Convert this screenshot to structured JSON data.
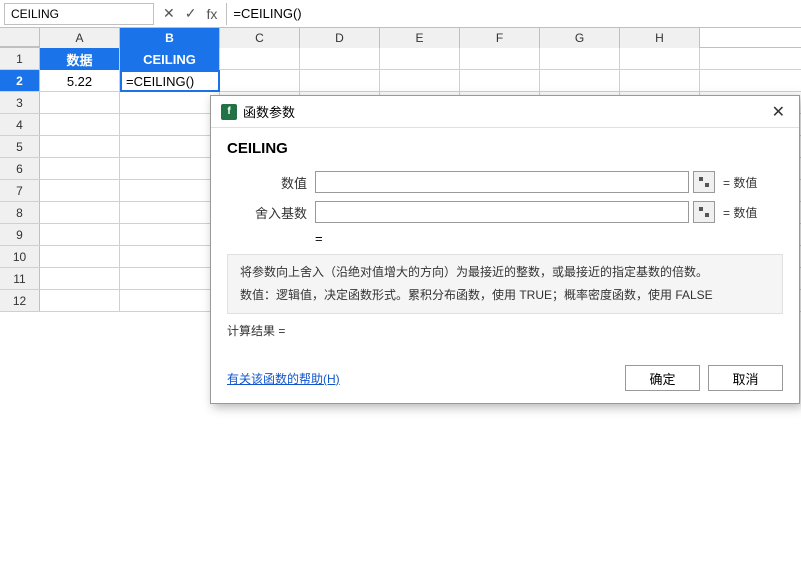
{
  "formulaBar": {
    "nameBox": "CEILING",
    "cancelIcon": "✕",
    "confirmIcon": "✓",
    "fxLabel": "fx",
    "formula": "=CEILING()"
  },
  "columns": [
    {
      "id": "A",
      "label": "A",
      "active": false
    },
    {
      "id": "B",
      "label": "B",
      "active": true
    },
    {
      "id": "C",
      "label": "C",
      "active": false
    },
    {
      "id": "D",
      "label": "D",
      "active": false
    },
    {
      "id": "E",
      "label": "E",
      "active": false
    },
    {
      "id": "F",
      "label": "F",
      "active": false
    },
    {
      "id": "G",
      "label": "G",
      "active": false
    },
    {
      "id": "H",
      "label": "H",
      "active": false
    }
  ],
  "rows": [
    {
      "num": "1",
      "active": false,
      "cells": [
        {
          "col": "A",
          "value": "数据",
          "type": "header"
        },
        {
          "col": "B",
          "value": "CEILING",
          "type": "header"
        },
        {
          "col": "C",
          "value": "",
          "type": "normal"
        },
        {
          "col": "D",
          "value": "",
          "type": "normal"
        },
        {
          "col": "E",
          "value": "",
          "type": "normal"
        },
        {
          "col": "F",
          "value": "",
          "type": "normal"
        },
        {
          "col": "G",
          "value": "",
          "type": "normal"
        }
      ]
    },
    {
      "num": "2",
      "active": true,
      "cells": [
        {
          "col": "A",
          "value": "5.22",
          "type": "value"
        },
        {
          "col": "B",
          "value": "=CEILING()",
          "type": "formula"
        },
        {
          "col": "C",
          "value": "",
          "type": "normal"
        },
        {
          "col": "D",
          "value": "",
          "type": "normal"
        },
        {
          "col": "E",
          "value": "",
          "type": "normal"
        },
        {
          "col": "F",
          "value": "",
          "type": "normal"
        },
        {
          "col": "G",
          "value": "",
          "type": "normal"
        }
      ]
    },
    {
      "num": "3",
      "active": false
    },
    {
      "num": "4",
      "active": false
    },
    {
      "num": "5",
      "active": false
    },
    {
      "num": "6",
      "active": false
    },
    {
      "num": "7",
      "active": false
    },
    {
      "num": "8",
      "active": false
    },
    {
      "num": "9",
      "active": false
    },
    {
      "num": "10",
      "active": false
    },
    {
      "num": "11",
      "active": false
    },
    {
      "num": "12",
      "active": false
    }
  ],
  "dialog": {
    "title": "函数参数",
    "titleIcon": "f",
    "funcName": "CEILING",
    "params": [
      {
        "label": "数值",
        "eqText": "= 数值"
      },
      {
        "label": "舍入基数",
        "eqText": "= 数值"
      }
    ],
    "resultLabel": "=",
    "descMain": "将参数向上舍入（沿绝对值增大的方向）为最接近的整数，或最接近的指定基数的倍数。",
    "descParam": "数值：逻辑值，决定函数形式。累积分布函数，使用 TRUE；概率密度函数，使用 FALSE",
    "calcResultLabel": "计算结果 =",
    "helpLink": "有关该函数的帮助(H)",
    "confirmBtn": "确定",
    "cancelBtn": "取消"
  }
}
